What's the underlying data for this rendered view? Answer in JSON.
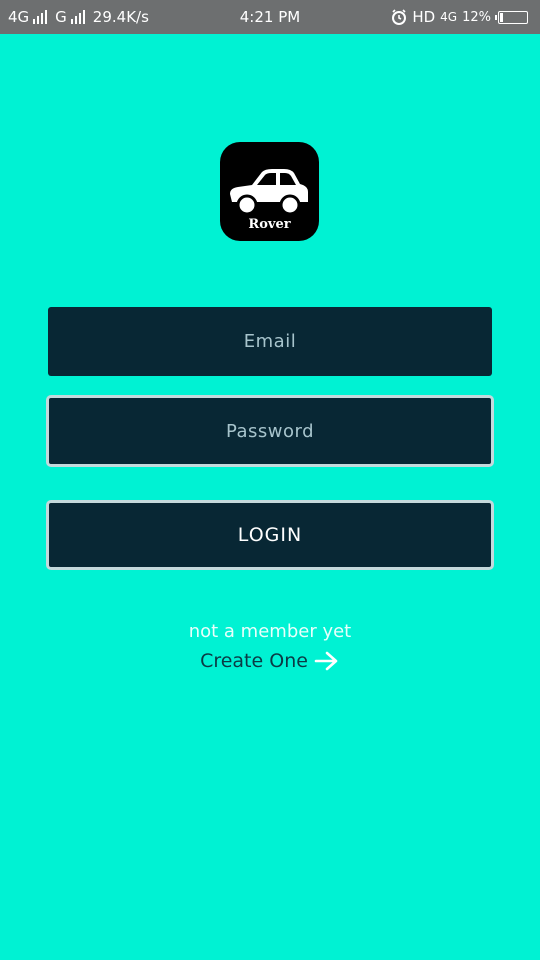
{
  "status_bar": {
    "network_1": "4G",
    "network_2": "G",
    "speed": "29.4K/s",
    "time": "4:21 PM",
    "hd": "HD",
    "network_3": "4G",
    "battery": "12%",
    "battery_level": 0.12
  },
  "app": {
    "logo_text": "Rover"
  },
  "form": {
    "email_placeholder": "Email",
    "password_placeholder": "Password",
    "login_label": "LOGIN"
  },
  "signup": {
    "prompt": "not a member yet",
    "link_label": "Create One"
  },
  "colors": {
    "background": "#00f2d3",
    "field": "#082734",
    "status_bar": "#6d6f70"
  },
  "icons": [
    "signal-icon",
    "alarm-icon",
    "battery-icon",
    "car-icon",
    "arrow-right-icon"
  ]
}
